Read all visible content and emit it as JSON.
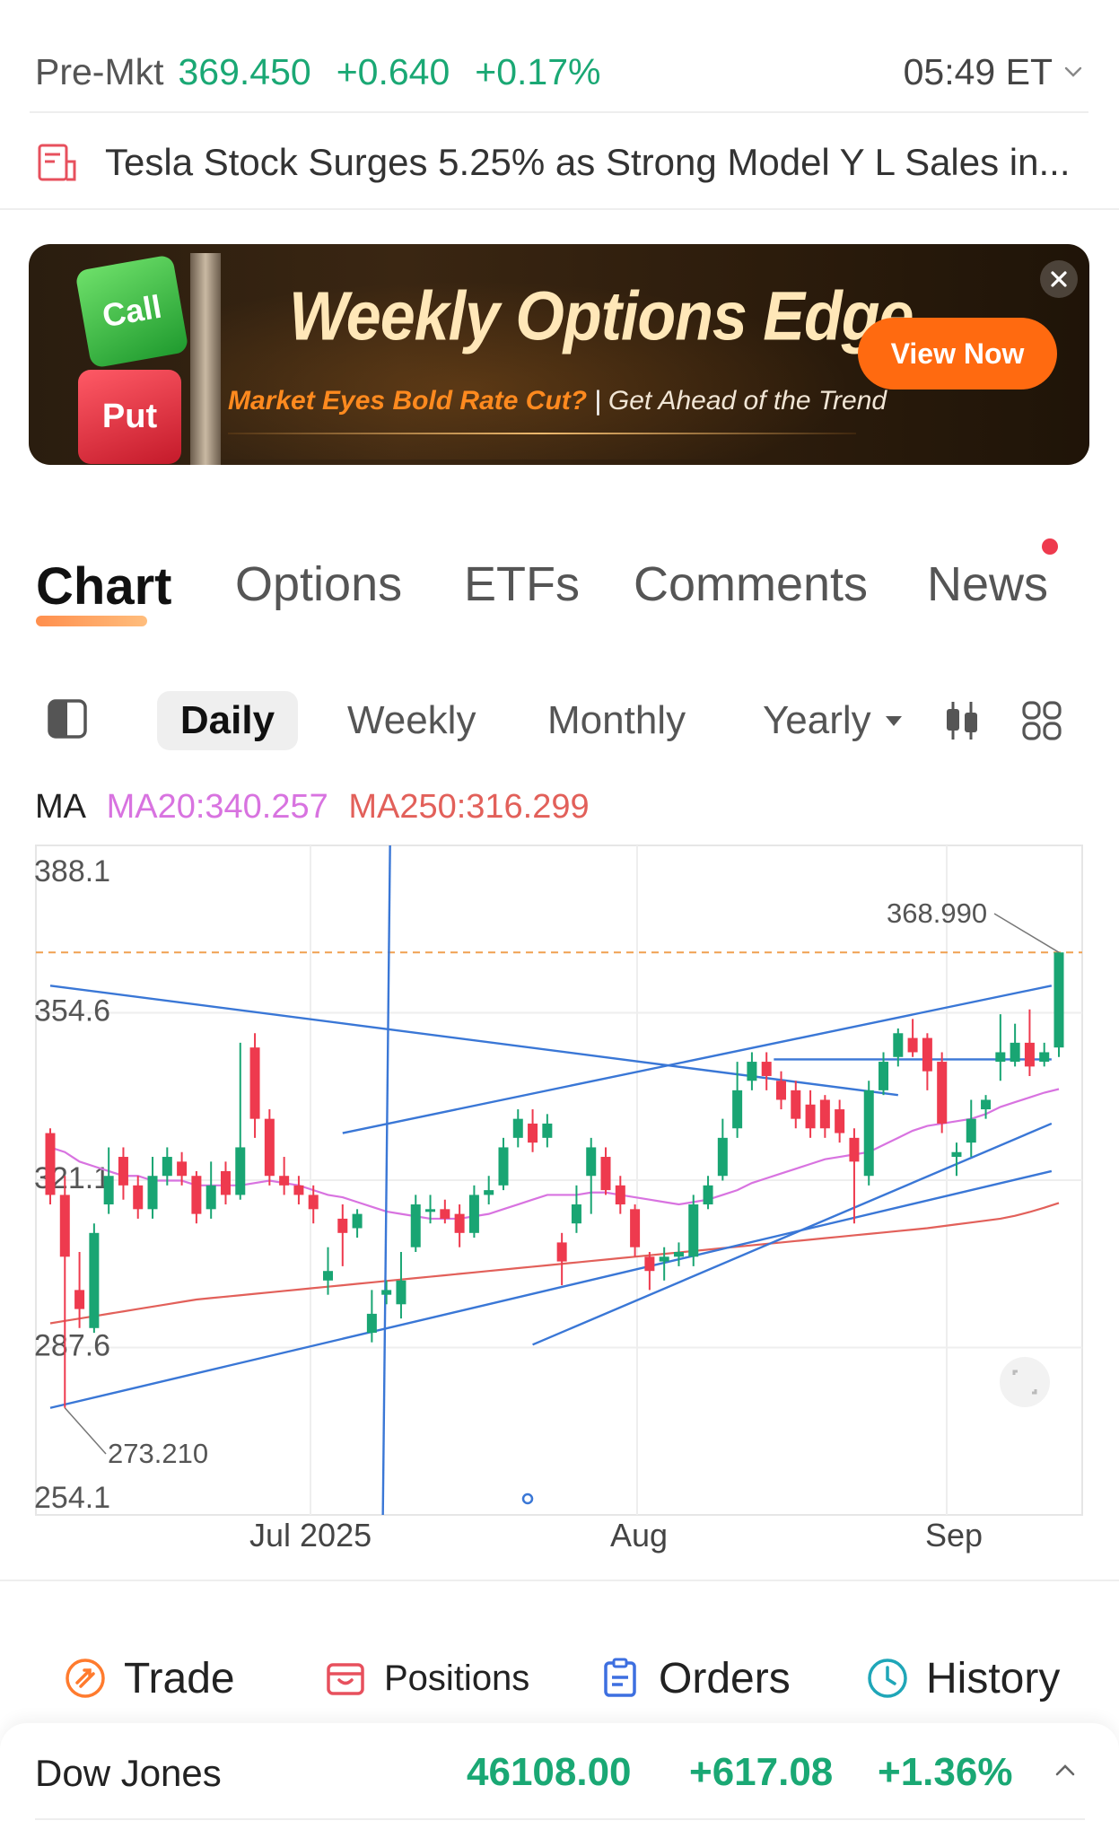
{
  "premarket": {
    "label": "Pre-Mkt",
    "price": "369.450",
    "change": "+0.640",
    "percent": "+0.17%",
    "time": "05:49 ET",
    "up_color": "#1aa874"
  },
  "news_headline": "Tesla Stock Surges 5.25% as Strong Model Y L Sales in...",
  "banner": {
    "call": "Call",
    "put": "Put",
    "headline": "Weekly Options Edge",
    "sub_highlight": "Market Eyes Bold Rate Cut?",
    "separator": "|",
    "sub_text": "Get Ahead of the Trend",
    "button": "View Now",
    "accent": "#ff6a10"
  },
  "tabs": [
    {
      "label": "Chart",
      "active": true
    },
    {
      "label": "Options"
    },
    {
      "label": "ETFs"
    },
    {
      "label": "Comments"
    },
    {
      "label": "News",
      "badge": "red-dot"
    }
  ],
  "periods": {
    "daily": "Daily",
    "weekly": "Weekly",
    "monthly": "Monthly",
    "yearly": "Yearly",
    "selected": "Daily"
  },
  "ma_legend": {
    "label": "MA",
    "ma20": "MA20:340.257",
    "ma250": "MA250:316.299",
    "ma20_color": "#d873e0",
    "ma250_color": "#e2605a"
  },
  "chart_data": {
    "type": "candlestick",
    "y_ticks": [
      "388.1",
      "354.6",
      "321.1",
      "287.6",
      "254.1"
    ],
    "ylim": [
      254.1,
      388.1
    ],
    "x_ticks": [
      "Jul 2025",
      "Aug",
      "Sep"
    ],
    "high_label": "368.990",
    "low_label": "273.210",
    "reference_line": 368.99,
    "up_color": "#19a573",
    "down_color": "#ee3a4e",
    "candles": [
      {
        "o": 331,
        "c": 318,
        "h": 332,
        "l": 316
      },
      {
        "o": 318,
        "c": 305,
        "h": 322,
        "l": 273.21
      },
      {
        "o": 298,
        "c": 294,
        "h": 306,
        "l": 290
      },
      {
        "o": 290,
        "c": 310,
        "h": 312,
        "l": 289
      },
      {
        "o": 316,
        "c": 322,
        "h": 328,
        "l": 314
      },
      {
        "o": 326,
        "c": 320,
        "h": 328,
        "l": 317
      },
      {
        "o": 320,
        "c": 315,
        "h": 322,
        "l": 313
      },
      {
        "o": 315,
        "c": 322,
        "h": 326,
        "l": 313
      },
      {
        "o": 322,
        "c": 326,
        "h": 328,
        "l": 320
      },
      {
        "o": 325,
        "c": 322,
        "h": 327,
        "l": 320
      },
      {
        "o": 322,
        "c": 314,
        "h": 323,
        "l": 312
      },
      {
        "o": 315,
        "c": 320,
        "h": 325,
        "l": 313
      },
      {
        "o": 323,
        "c": 318,
        "h": 325,
        "l": 316
      },
      {
        "o": 318,
        "c": 328,
        "h": 350,
        "l": 317
      },
      {
        "o": 349,
        "c": 334,
        "h": 352,
        "l": 330
      },
      {
        "o": 334,
        "c": 322,
        "h": 336,
        "l": 320
      },
      {
        "o": 322,
        "c": 320,
        "h": 326,
        "l": 318
      },
      {
        "o": 320,
        "c": 318,
        "h": 322,
        "l": 316
      },
      {
        "o": 318,
        "c": 315,
        "h": 320,
        "l": 312
      },
      {
        "o": 300,
        "c": 302,
        "h": 307,
        "l": 297
      },
      {
        "o": 313,
        "c": 310,
        "h": 316,
        "l": 303
      },
      {
        "o": 311,
        "c": 314,
        "h": 315,
        "l": 309
      },
      {
        "o": 289,
        "c": 293,
        "h": 298,
        "l": 287
      },
      {
        "o": 297,
        "c": 298,
        "h": 300,
        "l": 295
      },
      {
        "o": 295,
        "c": 300,
        "h": 306,
        "l": 292
      },
      {
        "o": 307,
        "c": 316,
        "h": 318,
        "l": 306
      },
      {
        "o": 315,
        "c": 315,
        "h": 318,
        "l": 312
      },
      {
        "o": 315,
        "c": 313,
        "h": 317,
        "l": 312
      },
      {
        "o": 314,
        "c": 310,
        "h": 316,
        "l": 307
      },
      {
        "o": 310,
        "c": 318,
        "h": 320,
        "l": 309
      },
      {
        "o": 318,
        "c": 319,
        "h": 322,
        "l": 316
      },
      {
        "o": 320,
        "c": 328,
        "h": 330,
        "l": 319
      },
      {
        "o": 330,
        "c": 334,
        "h": 336,
        "l": 328
      },
      {
        "o": 333,
        "c": 329,
        "h": 336,
        "l": 327
      },
      {
        "o": 330,
        "c": 333,
        "h": 335,
        "l": 328
      },
      {
        "o": 308,
        "c": 304,
        "h": 310,
        "l": 299
      },
      {
        "o": 312,
        "c": 316,
        "h": 320,
        "l": 310
      },
      {
        "o": 322,
        "c": 328,
        "h": 330,
        "l": 314
      },
      {
        "o": 326,
        "c": 319,
        "h": 328,
        "l": 318
      },
      {
        "o": 320,
        "c": 316,
        "h": 322,
        "l": 314
      },
      {
        "o": 315,
        "c": 307,
        "h": 316,
        "l": 305
      },
      {
        "o": 305,
        "c": 302,
        "h": 306,
        "l": 298
      },
      {
        "o": 304,
        "c": 305,
        "h": 307,
        "l": 300
      },
      {
        "o": 305,
        "c": 306,
        "h": 308,
        "l": 303
      },
      {
        "o": 305,
        "c": 316,
        "h": 318,
        "l": 303
      },
      {
        "o": 316,
        "c": 320,
        "h": 322,
        "l": 315
      },
      {
        "o": 322,
        "c": 330,
        "h": 334,
        "l": 321
      },
      {
        "o": 332,
        "c": 340,
        "h": 346,
        "l": 330
      },
      {
        "o": 342,
        "c": 346,
        "h": 348,
        "l": 340
      },
      {
        "o": 346,
        "c": 343,
        "h": 348,
        "l": 340
      },
      {
        "o": 342,
        "c": 338,
        "h": 344,
        "l": 336
      },
      {
        "o": 340,
        "c": 334,
        "h": 342,
        "l": 332
      },
      {
        "o": 337,
        "c": 332,
        "h": 340,
        "l": 330
      },
      {
        "o": 338,
        "c": 332,
        "h": 339,
        "l": 330
      },
      {
        "o": 336,
        "c": 331,
        "h": 338,
        "l": 329
      },
      {
        "o": 330,
        "c": 325,
        "h": 332,
        "l": 312
      },
      {
        "o": 322,
        "c": 340,
        "h": 342,
        "l": 320
      },
      {
        "o": 340,
        "c": 346,
        "h": 348,
        "l": 339
      },
      {
        "o": 347,
        "c": 352,
        "h": 353,
        "l": 345
      },
      {
        "o": 351,
        "c": 348,
        "h": 355,
        "l": 347
      },
      {
        "o": 351,
        "c": 344,
        "h": 352,
        "l": 340
      },
      {
        "o": 346,
        "c": 333,
        "h": 348,
        "l": 331
      },
      {
        "o": 326,
        "c": 327,
        "h": 329,
        "l": 322
      },
      {
        "o": 329,
        "c": 334,
        "h": 338,
        "l": 326
      },
      {
        "o": 336,
        "c": 338,
        "h": 339,
        "l": 334
      },
      {
        "o": 346,
        "c": 348,
        "h": 356,
        "l": 342
      },
      {
        "o": 346,
        "c": 350,
        "h": 354,
        "l": 345
      },
      {
        "o": 350,
        "c": 345,
        "h": 357,
        "l": 343
      },
      {
        "o": 346,
        "c": 348,
        "h": 350,
        "l": 345
      },
      {
        "o": 349,
        "c": 368.99,
        "h": 369,
        "l": 347
      }
    ],
    "ma20": [
      328,
      327,
      325,
      324,
      323,
      322,
      322,
      321,
      321,
      321,
      320,
      320,
      320,
      320,
      320.5,
      321,
      320.5,
      320,
      319,
      318,
      317.5,
      316.5,
      315.5,
      314.5,
      314,
      313.5,
      313,
      313,
      313,
      313.5,
      314,
      315,
      316,
      317,
      318,
      318,
      318,
      318.5,
      318.5,
      318,
      317.5,
      317,
      316.5,
      316,
      316.5,
      317,
      318,
      319,
      320.5,
      321.5,
      322.5,
      323.5,
      324.5,
      325.5,
      326,
      326.5,
      327,
      328.5,
      330,
      331.5,
      332.5,
      333,
      333.5,
      334,
      335,
      336.5,
      337.5,
      338.5,
      339.5,
      340.257
    ],
    "ma250": [
      291,
      291.5,
      292,
      292.5,
      293,
      293.5,
      294,
      294.5,
      295,
      295.5,
      296,
      296.3,
      296.6,
      296.9,
      297.2,
      297.5,
      297.8,
      298.1,
      298.4,
      298.7,
      299,
      299.3,
      299.6,
      299.9,
      300.2,
      300.5,
      300.8,
      301.1,
      301.4,
      301.7,
      302,
      302.3,
      302.6,
      302.9,
      303.2,
      303.5,
      303.8,
      304.1,
      304.4,
      304.7,
      305,
      305.3,
      305.6,
      305.9,
      306.2,
      306.5,
      306.8,
      307.1,
      307.4,
      307.7,
      308,
      308.3,
      308.6,
      308.9,
      309.2,
      309.5,
      309.8,
      310.1,
      310.4,
      310.7,
      311,
      311.4,
      311.8,
      312.2,
      312.6,
      313,
      313.6,
      314.4,
      315.3,
      316.299
    ],
    "trendlines": [
      {
        "x0": 0,
        "y0": 362,
        "x1": 58,
        "y1": 339
      },
      {
        "x0": 0,
        "y0": 273.21,
        "x1": 68.5,
        "y1": 323
      },
      {
        "x0": 20,
        "y0": 331,
        "x1": 68.5,
        "y1": 362
      },
      {
        "x0": 33,
        "y0": 286.5,
        "x1": 68.5,
        "y1": 333
      },
      {
        "x0": 49.5,
        "y0": 346.5,
        "x1": 68.5,
        "y1": 346.5
      }
    ],
    "vertical_marker_index": 23
  },
  "axis_labels": {
    "jul": "Jul 2025",
    "aug": "Aug",
    "sep": "Sep"
  },
  "actions": {
    "trade": "Trade",
    "positions": "Positions",
    "orders": "Orders",
    "history": "History"
  },
  "index_ticker": {
    "name": "Dow Jones",
    "value": "46108.00",
    "change": "+617.08",
    "percent": "+1.36%"
  }
}
